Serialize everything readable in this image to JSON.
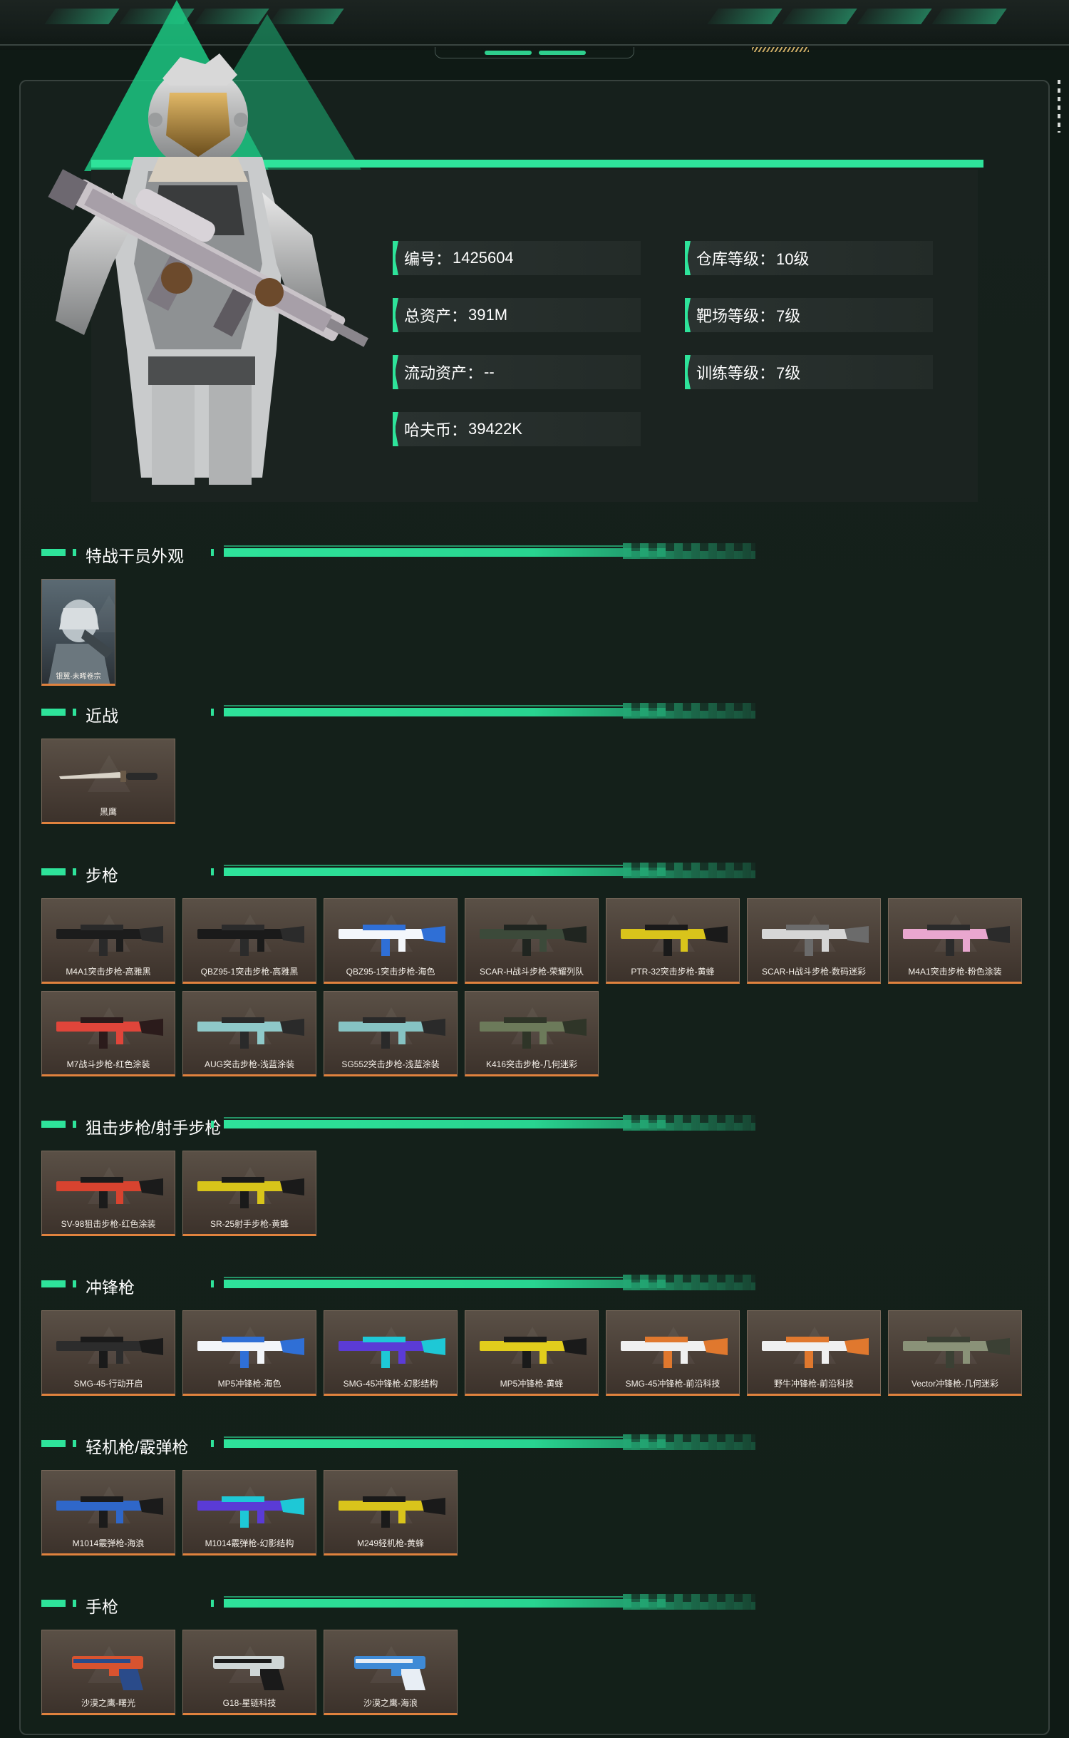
{
  "hero": {
    "fields": [
      {
        "key": "编号：",
        "value": "1425604"
      },
      {
        "key": "仓库等级：",
        "value": "10级"
      },
      {
        "key": "总资产：",
        "value": "391M"
      },
      {
        "key": "靶场等级：",
        "value": "7级"
      },
      {
        "key": "流动资产：",
        "value": "--"
      },
      {
        "key": "训练等级：",
        "value": "7级"
      },
      {
        "key": "哈夫币：",
        "value": "39422K"
      }
    ]
  },
  "sections": [
    {
      "title": "特战干员外观",
      "items": [
        "银翼-未晞卷宗"
      ]
    },
    {
      "title": "近战",
      "items": [
        "黑鹰"
      ]
    },
    {
      "title": "步枪",
      "items": [
        "M4A1突击步枪-高雅黑",
        "QBZ95-1突击步枪-高雅黑",
        "QBZ95-1突击步枪-海色",
        "SCAR-H战斗步枪-荣耀列队",
        "PTR-32突击步枪-黄蜂",
        "SCAR-H战斗步枪-数码迷彩",
        "M4A1突击步枪-粉色涂装",
        "M7战斗步枪-红色涂装",
        "AUG突击步枪-浅蓝涂装",
        "SG552突击步枪-浅蓝涂装",
        "K416突击步枪-几何迷彩"
      ]
    },
    {
      "title": "狙击步枪/射手步枪",
      "items": [
        "SV-98狙击步枪-红色涂装",
        "SR-25射手步枪-黄蜂"
      ]
    },
    {
      "title": "冲锋枪",
      "items": [
        "SMG-45-行动开启",
        "MP5冲锋枪-海色",
        "SMG-45冲锋枪-幻影结构",
        "MP5冲锋枪-黄蜂",
        "SMG-45冲锋枪-前沿科技",
        "野牛冲锋枪-前沿科技",
        "Vector冲锋枪-几何迷彩"
      ]
    },
    {
      "title": "轻机枪/霰弹枪",
      "items": [
        "M1014霰弹枪-海浪",
        "M1014霰弹枪-幻影结构",
        "M249轻机枪-黄蜂"
      ]
    },
    {
      "title": "手枪",
      "items": [
        "沙漠之鹰-曙光",
        "G18-星链科技",
        "沙漠之鹰-海浪"
      ]
    }
  ],
  "colors": {
    "accent": "#2ee39a",
    "card_border_bottom": "#e0823e",
    "background": "#0f1a15"
  },
  "weapon_colors": {
    "M4A1突击步枪-高雅黑": [
      "#1c1c1c",
      "#2a2a2a"
    ],
    "QBZ95-1突击步枪-高雅黑": [
      "#1a1a1a",
      "#2b2b2b"
    ],
    "QBZ95-1突击步枪-海色": [
      "#f4f7fb",
      "#2f6fd6"
    ],
    "SCAR-H战斗步枪-荣耀列队": [
      "#3c4a3a",
      "#202520"
    ],
    "PTR-32突击步枪-黄蜂": [
      "#d9c41b",
      "#1a1a1a"
    ],
    "SCAR-H战斗步枪-数码迷彩": [
      "#d6d6d6",
      "#6b6b6b"
    ],
    "M4A1突击步枪-粉色涂装": [
      "#e9a7cf",
      "#2b2b2b"
    ],
    "M7战斗步枪-红色涂装": [
      "#e0453a",
      "#2b1b1b"
    ],
    "AUG突击步枪-浅蓝涂装": [
      "#8fc9c9",
      "#2a2a2a"
    ],
    "SG552突击步枪-浅蓝涂装": [
      "#86c3c3",
      "#2a2a2a"
    ],
    "K416突击步枪-几何迷彩": [
      "#6c7a5a",
      "#2f3528"
    ],
    "SV-98狙击步枪-红色涂装": [
      "#d8432f",
      "#1b1b1b"
    ],
    "SR-25射手步枪-黄蜂": [
      "#d8c41a",
      "#1a1a1a"
    ],
    "SMG-45-行动开启": [
      "#2c2c2c",
      "#1a1a1a"
    ],
    "MP5冲锋枪-海色": [
      "#f2f5f9",
      "#2f6fd6"
    ],
    "SMG-45冲锋枪-幻影结构": [
      "#5b3bd6",
      "#1ec8d6"
    ],
    "MP5冲锋枪-黄蜂": [
      "#e2cd1c",
      "#1a1a1a"
    ],
    "SMG-45冲锋枪-前沿科技": [
      "#f0f0f0",
      "#e0782e"
    ],
    "野牛冲锋枪-前沿科技": [
      "#f0f0f0",
      "#e0782e"
    ],
    "Vector冲锋枪-几何迷彩": [
      "#8a9278",
      "#3b4034"
    ],
    "M1014霰弹枪-海浪": [
      "#2f67c9",
      "#1b1b1b"
    ],
    "M1014霰弹枪-幻影结构": [
      "#5a3bd6",
      "#1ec8d6"
    ],
    "M249轻机枪-黄蜂": [
      "#d9c41b",
      "#1a1a1a"
    ],
    "沙漠之鹰-曙光": [
      "#d8532f",
      "#2a4b8a"
    ],
    "G18-星链科技": [
      "#cfd6d6",
      "#1a1a1a"
    ],
    "沙漠之鹰-海浪": [
      "#3e8ad6",
      "#e8eef5"
    ],
    "黑鹰": [
      "#d9d3c8",
      "#2a2a2a"
    ]
  }
}
